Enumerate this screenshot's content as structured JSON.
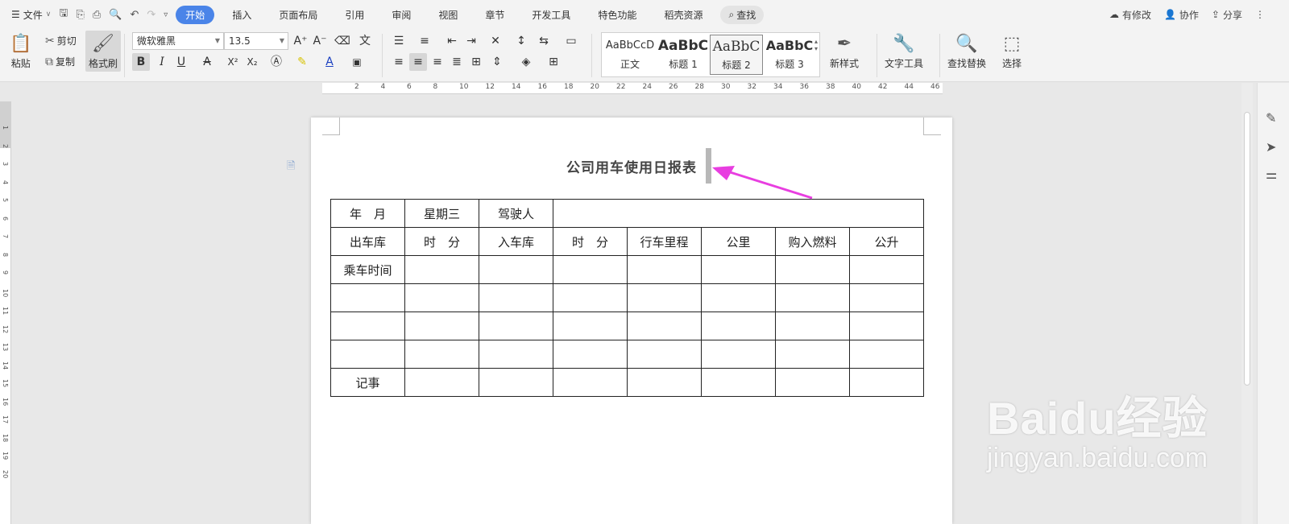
{
  "menubar": {
    "file_label": "文件",
    "tabs": [
      "开始",
      "插入",
      "页面布局",
      "引用",
      "审阅",
      "视图",
      "章节",
      "开发工具",
      "特色功能",
      "稻壳资源"
    ],
    "search_label": "查找",
    "right": {
      "modified": "有修改",
      "collab": "协作",
      "share": "分享"
    }
  },
  "ribbon": {
    "paste": "粘贴",
    "cut": "剪切",
    "copy": "复制",
    "format_painter": "格式刷",
    "font_name": "微软雅黑",
    "font_size": "13.5",
    "bold": "B",
    "italic": "I",
    "underline": "U",
    "strike": "A",
    "superscript": "X²",
    "subscript": "X₂",
    "styles": [
      {
        "sample": "AaBbCcD",
        "name": "正文"
      },
      {
        "sample": "AaBbC",
        "name": "标题 1"
      },
      {
        "sample": "AaBbC",
        "name": "标题 2"
      },
      {
        "sample": "AaBbC",
        "name": "标题 3"
      }
    ],
    "new_style": "新样式",
    "text_tools": "文字工具",
    "find_replace": "查找替换",
    "select": "选择"
  },
  "ruler": {
    "h_ticks": [
      "2",
      "4",
      "6",
      "8",
      "10",
      "12",
      "14",
      "16",
      "18",
      "20",
      "22",
      "24",
      "26",
      "28",
      "30",
      "32",
      "34",
      "36",
      "38",
      "40",
      "42",
      "44",
      "46"
    ],
    "v_ticks": [
      "1",
      "2",
      "3",
      "4",
      "5",
      "6",
      "7",
      "8",
      "9",
      "10",
      "11",
      "12",
      "13",
      "14",
      "15",
      "16",
      "17",
      "18",
      "19",
      "20"
    ]
  },
  "document": {
    "title": "公司用车使用日报表",
    "table": [
      [
        "年　月",
        "星期三",
        "驾驶人",
        "",
        "",
        "",
        "",
        ""
      ],
      [
        "出车库",
        "时　分",
        "入车库",
        "时　分",
        "行车里程",
        "公里",
        "购入燃料",
        "公升"
      ],
      [
        "乘车时间",
        "",
        "",
        "",
        "",
        "",
        "",
        ""
      ],
      [
        "",
        "",
        "",
        "",
        "",
        "",
        "",
        ""
      ],
      [
        "",
        "",
        "",
        "",
        "",
        "",
        "",
        ""
      ],
      [
        "",
        "",
        "",
        "",
        "",
        "",
        "",
        ""
      ],
      [
        "记事",
        "",
        "",
        "",
        "",
        "",
        "",
        ""
      ]
    ]
  },
  "watermark": {
    "brand": "Baidu经验",
    "url": "jingyan.baidu.com"
  },
  "colors": {
    "accent": "#4a84e8",
    "arrow": "#e83ee0"
  }
}
